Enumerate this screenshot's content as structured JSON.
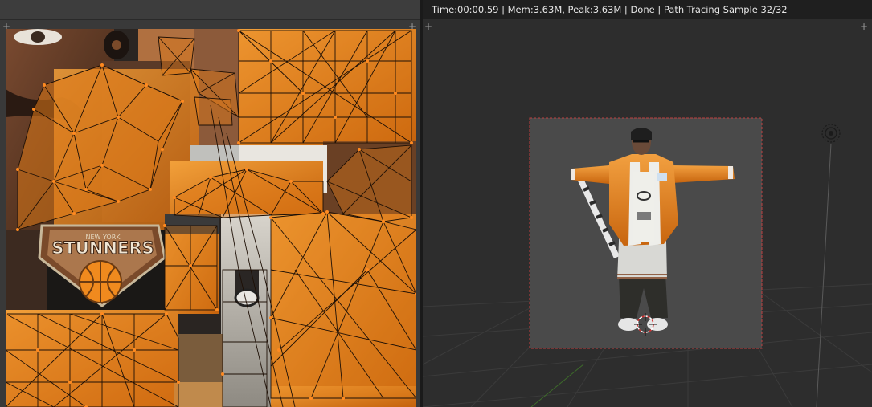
{
  "status_bar": {
    "text": "Time:00:00.59 | Mem:3.63M, Peak:3.63M | Done | Path Tracing Sample 32/32"
  },
  "texture": {
    "logo_text": "STUNNERS",
    "logo_subtext": "NEW YORK"
  },
  "icons": {
    "corner_plus": "+",
    "light": "light-icon",
    "cursor": "3d-cursor-icon"
  },
  "colors": {
    "uv_edge": "#e07818",
    "uv_vertex": "#ff8a20",
    "status_bg": "#1f1f1f",
    "viewport_bg": "#2d2d2d",
    "render_bg": "#4a4a4a",
    "jacket": "#e8891e"
  }
}
